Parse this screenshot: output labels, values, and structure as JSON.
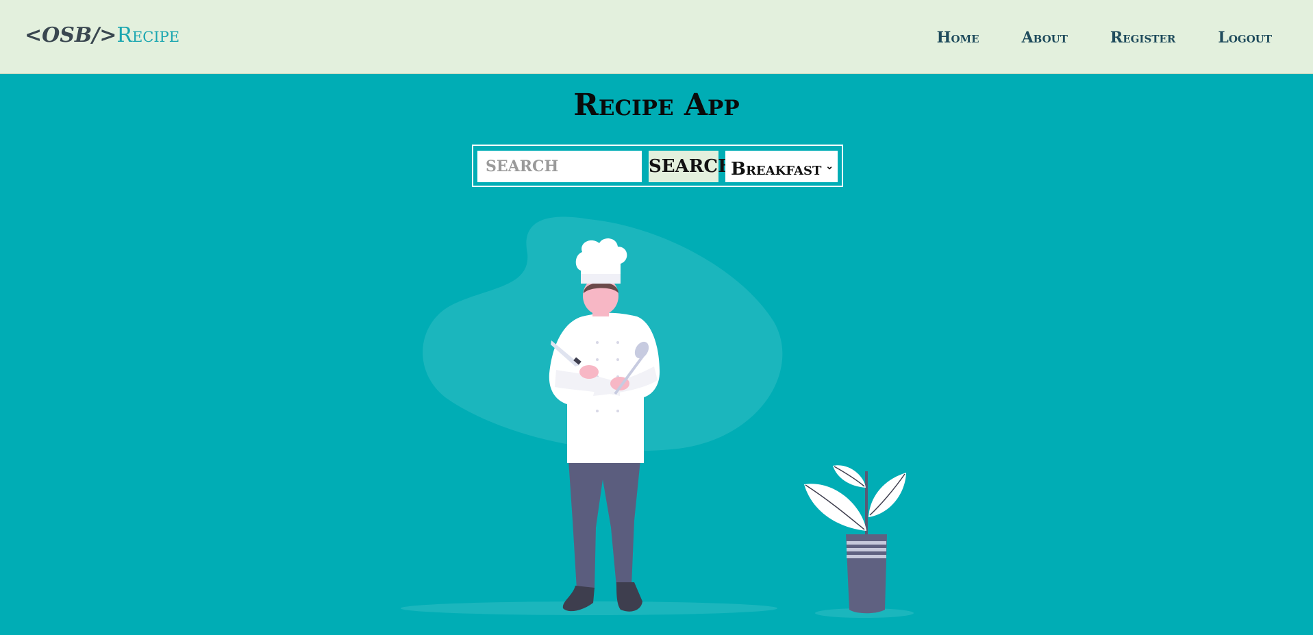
{
  "brand": {
    "code": "<OSB/>",
    "name": "Recipe"
  },
  "nav": {
    "home": "Home",
    "about": "About",
    "register": "Register",
    "logout": "Logout"
  },
  "page_title": "Recipe App",
  "search": {
    "placeholder": "SEARCH",
    "value": "",
    "button_label": "SEARCH"
  },
  "category": {
    "selected": "Breakfast"
  },
  "icons": {
    "dropdown": "chevron-down-icon"
  },
  "colors": {
    "background": "#00adb5",
    "navbar": "#e3f0dd",
    "brand_accent": "#1aa6b0"
  }
}
